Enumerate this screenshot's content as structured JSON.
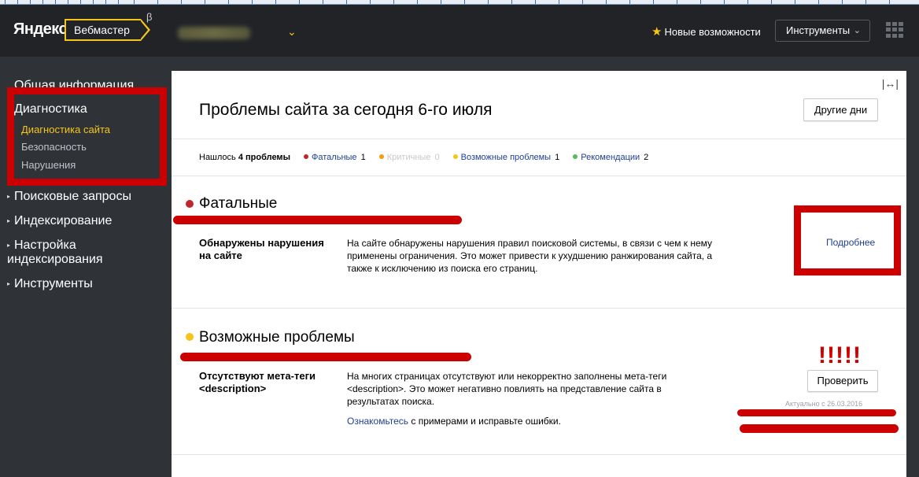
{
  "header": {
    "logo": "Яндекс",
    "product": "Вебмастер",
    "beta": "β",
    "news_label": "Новые возможности",
    "tools_label": "Инструменты"
  },
  "sidebar": {
    "items": [
      {
        "label": "Общая информация"
      },
      {
        "label": "Диагностика"
      },
      {
        "label": "Поисковые запросы"
      },
      {
        "label": "Индексирование"
      },
      {
        "label": "Настройка индексирования"
      },
      {
        "label": "Инструменты"
      }
    ],
    "subitems": [
      {
        "label": "Диагностика сайта"
      },
      {
        "label": "Безопасность"
      },
      {
        "label": "Нарушения"
      }
    ]
  },
  "main": {
    "title": "Проблемы сайта за сегодня 6-го июля",
    "other_days": "Другие дни",
    "summary": {
      "prefix": "Нашлось",
      "count": "4 проблемы",
      "fatal_label": "Фатальные",
      "fatal_count": "1",
      "critical_label": "Критичные",
      "critical_count": "0",
      "possible_label": "Возможные проблемы",
      "possible_count": "1",
      "rec_label": "Рекомендации",
      "rec_count": "2"
    },
    "sections": {
      "fatal": {
        "title": "Фатальные",
        "issue_name": "Обнаружены нарушения на сайте",
        "issue_desc": "На сайте обнаружены нарушения правил поисковой системы, в связи с чем к нему применены ограничения. Это может привести к ухудшению ранжирования сайта, а также к исключению из поиска его страниц.",
        "more": "Подробнее"
      },
      "possible": {
        "title": "Возможные проблемы",
        "issue_name": "Отсутствуют мета-теги <description>",
        "issue_desc": "На многих страницах отсутствуют или некорректно заполнены мета-теги <description>. Это может негативно повлиять на представление сайта в результатах поиска.",
        "link": "Ознакомьтесь",
        "link_tail": " с примерами и исправьте ошибки.",
        "check": "Проверить",
        "actual": "Актуально с 26.03.2016",
        "exclam": "!!!!!"
      }
    }
  },
  "colors": {
    "fatal": "#c0272d",
    "critical": "#f39c12",
    "possible": "#f5c518",
    "recommend": "#5cb85c",
    "highlight_red": "#cc0000"
  }
}
